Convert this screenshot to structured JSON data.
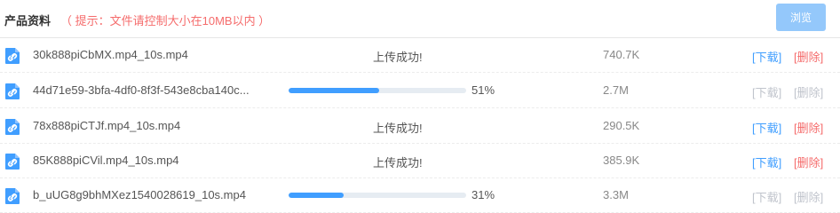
{
  "header": {
    "title": "产品资料",
    "hint": "（ 提示：文件请控制大小在10MB以内 ）",
    "browse_label": "浏览"
  },
  "colors": {
    "accent": "#409eff",
    "danger": "#f56c6c",
    "disabled": "#c0c4cc",
    "browse_bg": "#94c8fb"
  },
  "files": [
    {
      "name": "30k888piCbMX.mp4_10s.mp4",
      "status": "上传成功!",
      "progress": null,
      "percent": "",
      "size": "740.7K",
      "download": "[下载]",
      "delete": "[删除]",
      "enabled": true
    },
    {
      "name": "44d71e59-3bfa-4df0-8f3f-543e8cba140c...",
      "status": "",
      "progress": 0.51,
      "percent": "51%",
      "size": "2.7M",
      "download": "[下载]",
      "delete": "[删除]",
      "enabled": false
    },
    {
      "name": "78x888piCTJf.mp4_10s.mp4",
      "status": "上传成功!",
      "progress": null,
      "percent": "",
      "size": "290.5K",
      "download": "[下载]",
      "delete": "[删除]",
      "enabled": true
    },
    {
      "name": "85K888piCVil.mp4_10s.mp4",
      "status": "上传成功!",
      "progress": null,
      "percent": "",
      "size": "385.9K",
      "download": "[下载]",
      "delete": "[删除]",
      "enabled": true
    },
    {
      "name": "b_uUG8g9bhMXez1540028619_10s.mp4",
      "status": "",
      "progress": 0.31,
      "percent": "31%",
      "size": "3.3M",
      "download": "[下载]",
      "delete": "[删除]",
      "enabled": false
    }
  ]
}
